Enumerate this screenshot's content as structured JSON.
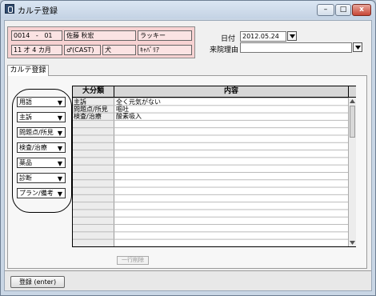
{
  "window": {
    "title": "カルテ登録",
    "minimize": "–",
    "maximize": "□",
    "close": "x"
  },
  "patient": {
    "id": "0014",
    "sep": "-",
    "sub": "01",
    "name": "佐藤 秋宏",
    "pet_name": "ラッキー",
    "age": "11 才 4 カ月",
    "sex": "♂(CAST)",
    "species": "犬",
    "breed": "ｷｬﾊﾞﾘｱ"
  },
  "date": {
    "label": "日付",
    "value": "2012.05.24"
  },
  "reason": {
    "label": "来院理由",
    "value": ""
  },
  "tabs": [
    {
      "label": "カルテ登録"
    }
  ],
  "side_buttons": [
    {
      "label": "用語"
    },
    {
      "label": "主訴"
    },
    {
      "label": "問題点/所見"
    },
    {
      "label": "検査/治療"
    },
    {
      "label": "薬品"
    },
    {
      "label": "診断"
    },
    {
      "label": "プラン/備考"
    }
  ],
  "grid": {
    "headers": [
      "大分類",
      "内容"
    ],
    "rows": [
      {
        "category": "主訴",
        "content": "全く元気がない"
      },
      {
        "category": "問題点/所見",
        "content": "嘔吐"
      },
      {
        "category": "検査/治療",
        "content": "酸素吸入"
      }
    ]
  },
  "delete_row_button": "一行削除",
  "register_button": "登録 (enter)",
  "colors": {
    "patient_bg": "#f7d2d2",
    "window_frame": "#c9d6e5"
  }
}
